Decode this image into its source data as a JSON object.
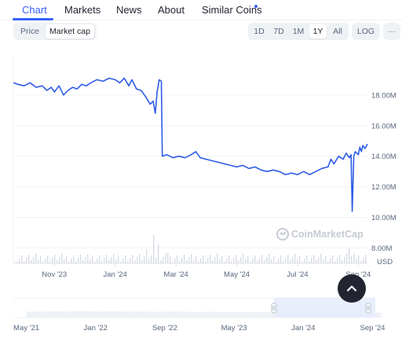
{
  "tabs": {
    "chart": "Chart",
    "markets": "Markets",
    "news": "News",
    "about": "About",
    "similar_coins": "Similar Coins"
  },
  "metric_toggle": {
    "price": "Price",
    "market_cap": "Market cap",
    "active": "Market cap"
  },
  "range_buttons": {
    "d1": "1D",
    "d7": "7D",
    "m1": "1M",
    "y1": "1Y",
    "all": "All",
    "log": "LOG",
    "more": "···",
    "active": "1Y"
  },
  "colors": {
    "accent": "#3861fb",
    "line": "#2e5ce6",
    "volume": "#d8dce3",
    "navigator_fill": "#e6ecfb"
  },
  "watermark": "CoinMarketCap",
  "scroll_top_icon": "chevron-up-icon",
  "chart_data": {
    "type": "line",
    "title": "",
    "ylabel": "USD",
    "y_ticks": [
      "8.00M",
      "10.00M",
      "12.00M",
      "14.00M",
      "16.00M",
      "18.00M"
    ],
    "y_tick_values": [
      8,
      10,
      12,
      14,
      16,
      18
    ],
    "ylim": [
      7,
      20.1
    ],
    "x_ticks": [
      "Nov '23",
      "Jan '24",
      "Mar '24",
      "May '24",
      "Jul '24",
      "Sep '24"
    ],
    "x_tick_values": [
      1.0,
      3.0,
      5.0,
      7.0,
      9.0,
      11.0
    ],
    "xlim": [
      -0.35,
      11.3
    ],
    "x_unit": "months since Oct 1 2023",
    "series": [
      {
        "name": "",
        "points": [
          [
            -0.35,
            18.8
          ],
          [
            -0.2,
            18.7
          ],
          [
            0.0,
            18.6
          ],
          [
            0.2,
            18.8
          ],
          [
            0.4,
            18.5
          ],
          [
            0.6,
            18.6
          ],
          [
            0.75,
            18.3
          ],
          [
            0.9,
            18.5
          ],
          [
            1.0,
            18.2
          ],
          [
            1.15,
            18.6
          ],
          [
            1.3,
            18.0
          ],
          [
            1.45,
            18.3
          ],
          [
            1.6,
            18.5
          ],
          [
            1.75,
            18.4
          ],
          [
            1.9,
            18.7
          ],
          [
            2.05,
            18.6
          ],
          [
            2.2,
            18.8
          ],
          [
            2.4,
            19.0
          ],
          [
            2.6,
            18.9
          ],
          [
            2.8,
            19.1
          ],
          [
            3.0,
            19.0
          ],
          [
            3.15,
            18.8
          ],
          [
            3.3,
            19.1
          ],
          [
            3.45,
            18.6
          ],
          [
            3.55,
            19.0
          ],
          [
            3.7,
            18.4
          ],
          [
            3.85,
            18.3
          ],
          [
            4.0,
            17.9
          ],
          [
            4.15,
            17.4
          ],
          [
            4.25,
            17.6
          ],
          [
            4.32,
            16.8
          ],
          [
            4.38,
            18.2
          ],
          [
            4.45,
            19.0
          ],
          [
            4.52,
            18.9
          ],
          [
            4.55,
            14.0
          ],
          [
            4.7,
            14.1
          ],
          [
            4.9,
            13.9
          ],
          [
            5.1,
            14.0
          ],
          [
            5.3,
            13.9
          ],
          [
            5.5,
            14.1
          ],
          [
            5.65,
            14.3
          ],
          [
            5.8,
            13.9
          ],
          [
            6.0,
            13.8
          ],
          [
            6.2,
            13.7
          ],
          [
            6.4,
            13.6
          ],
          [
            6.6,
            13.5
          ],
          [
            6.8,
            13.4
          ],
          [
            7.0,
            13.3
          ],
          [
            7.2,
            13.4
          ],
          [
            7.4,
            13.2
          ],
          [
            7.6,
            13.3
          ],
          [
            7.8,
            13.1
          ],
          [
            8.0,
            13.0
          ],
          [
            8.2,
            13.1
          ],
          [
            8.4,
            13.0
          ],
          [
            8.6,
            12.8
          ],
          [
            8.8,
            12.9
          ],
          [
            9.0,
            12.8
          ],
          [
            9.2,
            13.0
          ],
          [
            9.4,
            12.8
          ],
          [
            9.6,
            13.0
          ],
          [
            9.8,
            13.2
          ],
          [
            10.0,
            13.3
          ],
          [
            10.1,
            13.8
          ],
          [
            10.2,
            13.5
          ],
          [
            10.35,
            14.0
          ],
          [
            10.5,
            13.8
          ],
          [
            10.6,
            14.2
          ],
          [
            10.7,
            13.9
          ],
          [
            10.76,
            14.1
          ],
          [
            10.8,
            10.4
          ],
          [
            10.85,
            14.0
          ],
          [
            10.9,
            14.3
          ],
          [
            11.0,
            14.1
          ],
          [
            11.05,
            14.6
          ],
          [
            11.1,
            14.3
          ],
          [
            11.15,
            14.7
          ],
          [
            11.22,
            14.5
          ],
          [
            11.3,
            14.8
          ]
        ]
      }
    ]
  },
  "navigator": {
    "x_ticks": [
      "May '21",
      "Jan '22",
      "Sep '22",
      "May '23",
      "Jan '24",
      "Sep '24"
    ],
    "x_tick_values": [
      0,
      8,
      16,
      24,
      32,
      40
    ],
    "xlim": [
      -1.5,
      40.5
    ],
    "selection": [
      28.6,
      40.5
    ],
    "values": [
      0.3,
      0.31,
      0.3,
      0.32,
      0.31,
      0.3,
      0.33,
      0.32,
      0.31,
      0.3,
      0.32,
      0.31,
      0.3,
      0.31,
      0.3,
      0.29,
      0.3,
      0.31,
      0.3,
      0.29,
      0.28,
      0.3,
      0.29,
      0.28,
      0.29,
      0.28,
      0.27,
      0.28,
      0.27,
      0.28,
      0.3,
      0.28,
      0.26,
      0.25,
      0.24,
      0.24,
      0.23,
      0.22,
      0.22,
      0.23,
      0.24,
      0.24
    ]
  }
}
